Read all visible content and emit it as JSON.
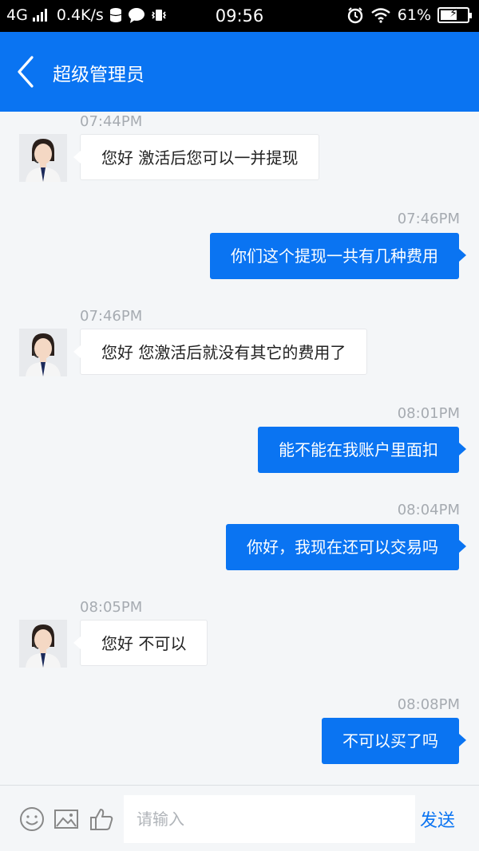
{
  "status_bar": {
    "network": "4G",
    "speed": "0.4K/s",
    "time": "09:56",
    "battery_percent": "61%",
    "battery_level": 0.61
  },
  "header": {
    "title": "超级管理员"
  },
  "messages": [
    {
      "time": "07:44PM",
      "text": "您好 激活后您可以一并提现",
      "direction": "incoming"
    },
    {
      "time": "07:46PM",
      "text": "你们这个提现一共有几种费用",
      "direction": "outgoing"
    },
    {
      "time": "07:46PM",
      "text": "您好 您激活后就没有其它的费用了",
      "direction": "incoming"
    },
    {
      "time": "08:01PM",
      "text": "能不能在我账户里面扣",
      "direction": "outgoing"
    },
    {
      "time": "08:04PM",
      "text": "你好，我现在还可以交易吗",
      "direction": "outgoing"
    },
    {
      "time": "08:05PM",
      "text": "您好 不可以",
      "direction": "incoming"
    },
    {
      "time": "08:08PM",
      "text": "不可以买了吗",
      "direction": "outgoing"
    }
  ],
  "input_bar": {
    "placeholder": "请输入",
    "send_label": "发送",
    "icons": [
      "emoji-icon",
      "image-icon",
      "thumbs-up-icon"
    ]
  },
  "colors": {
    "brand": "#0a74f2",
    "background": "#f4f6f8",
    "timestamp": "#a6abb1"
  }
}
